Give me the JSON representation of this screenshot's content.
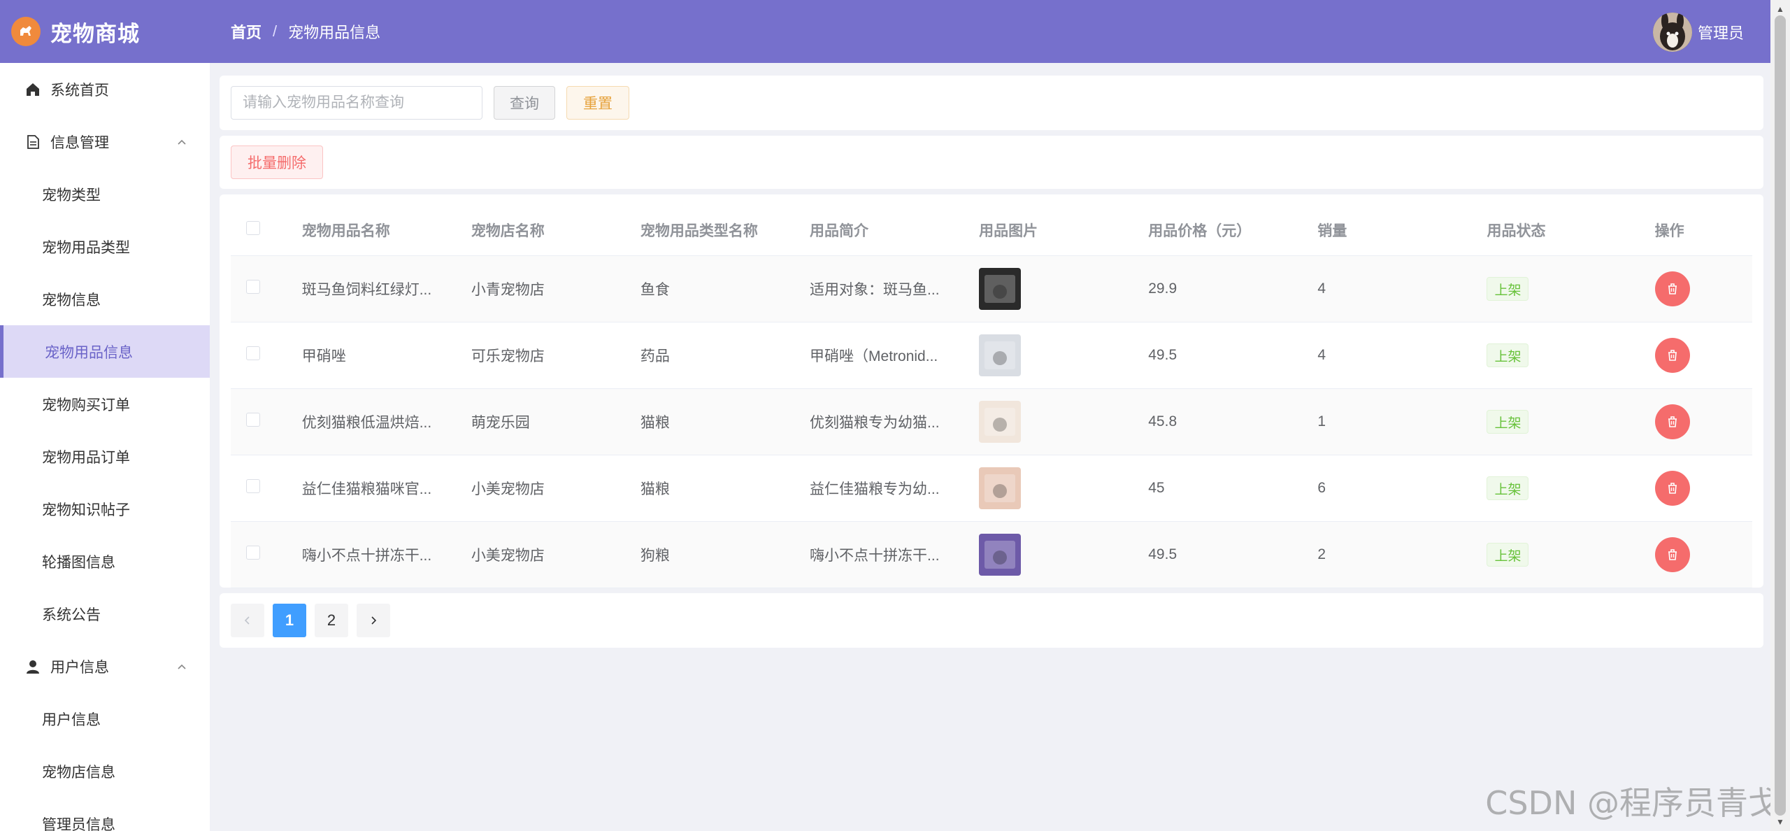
{
  "app": {
    "title": "宠物商城",
    "user_name": "管理员"
  },
  "breadcrumb": {
    "home": "首页",
    "current": "宠物用品信息"
  },
  "sidebar": {
    "items": [
      {
        "label": "系统首页",
        "icon": "home-icon",
        "type": "top"
      },
      {
        "label": "信息管理",
        "icon": "document-icon",
        "type": "group"
      },
      {
        "label": "宠物类型",
        "type": "sub"
      },
      {
        "label": "宠物用品类型",
        "type": "sub"
      },
      {
        "label": "宠物信息",
        "type": "sub"
      },
      {
        "label": "宠物用品信息",
        "type": "sub",
        "active": true
      },
      {
        "label": "宠物购买订单",
        "type": "sub"
      },
      {
        "label": "宠物用品订单",
        "type": "sub"
      },
      {
        "label": "宠物知识帖子",
        "type": "sub"
      },
      {
        "label": "轮播图信息",
        "type": "sub"
      },
      {
        "label": "系统公告",
        "type": "sub"
      },
      {
        "label": "用户信息",
        "icon": "user-icon",
        "type": "group"
      },
      {
        "label": "用户信息",
        "type": "sub"
      },
      {
        "label": "宠物店信息",
        "type": "sub"
      },
      {
        "label": "管理员信息",
        "type": "sub"
      }
    ]
  },
  "search": {
    "placeholder": "请输入宠物用品名称查询",
    "query_label": "查询",
    "reset_label": "重置"
  },
  "actions": {
    "batch_delete_label": "批量删除"
  },
  "table": {
    "headers": [
      "宠物用品名称",
      "宠物店名称",
      "宠物用品类型名称",
      "用品简介",
      "用品图片",
      "用品价格（元）",
      "销量",
      "用品状态",
      "操作"
    ],
    "rows": [
      {
        "name": "斑马鱼饲料红绿灯...",
        "shop": "小青宠物店",
        "type": "鱼食",
        "intro": "适用对象：斑马鱼...",
        "price": "29.9",
        "sales": "4",
        "status": "上架",
        "image_color": "#2a2a2a"
      },
      {
        "name": "甲硝唑",
        "shop": "可乐宠物店",
        "type": "药品",
        "intro": "甲硝唑（Metronid...",
        "price": "49.5",
        "sales": "4",
        "status": "上架",
        "image_color": "#d9dde3"
      },
      {
        "name": "优刻猫粮低温烘焙...",
        "shop": "萌宠乐园",
        "type": "猫粮",
        "intro": "优刻猫粮专为幼猫...",
        "price": "45.8",
        "sales": "1",
        "status": "上架",
        "image_color": "#f1e6dc"
      },
      {
        "name": "益仁佳猫粮猫咪官...",
        "shop": "小美宠物店",
        "type": "猫粮",
        "intro": "益仁佳猫粮专为幼...",
        "price": "45",
        "sales": "6",
        "status": "上架",
        "image_color": "#e9c9b8"
      },
      {
        "name": "嗨小不点十拼冻干...",
        "shop": "小美宠物店",
        "type": "狗粮",
        "intro": "嗨小不点十拼冻干...",
        "price": "49.5",
        "sales": "2",
        "status": "上架",
        "image_color": "#6d5aa8"
      }
    ]
  },
  "pagination": {
    "pages": [
      "1",
      "2"
    ],
    "current": "1"
  },
  "watermark": "CSDN @程序员青戈",
  "colors": {
    "header": "#7670cc",
    "primary": "#409eff",
    "danger": "#f56c6c",
    "success": "#67c23a",
    "warning": "#e6a23c"
  }
}
